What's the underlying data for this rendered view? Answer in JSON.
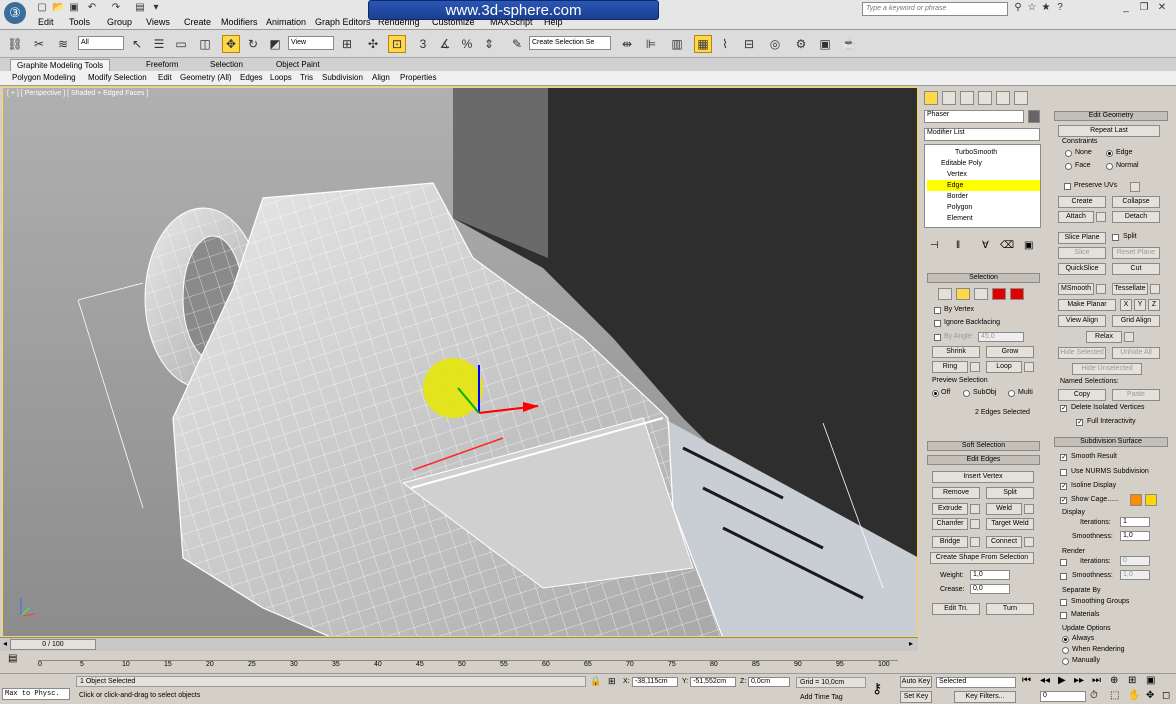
{
  "menubar": {
    "items": [
      "Edit",
      "Tools",
      "Group",
      "Views",
      "Create",
      "Modifiers",
      "Animation",
      "Graph Editors",
      "Rendering",
      "Customize",
      "MAXScript",
      "Help"
    ],
    "watermark": "www.3d-sphere.com",
    "search_placeholder": "Type a keyword or phrase"
  },
  "toolbar": {
    "selection_filter": "All",
    "ref_coord": "View",
    "named_selection": "Create Selection Se"
  },
  "ribbon": {
    "tabs": [
      "Graphite Modeling Tools",
      "Freeform",
      "Selection",
      "Object Paint"
    ],
    "items": [
      "Polygon Modeling",
      "Modify Selection",
      "Edit",
      "Geometry (All)",
      "Edges",
      "Loops",
      "Tris",
      "Subdivision",
      "Align",
      "Properties"
    ]
  },
  "viewport": {
    "label": "[ + ] [ Perspective ] [ Shaded + Edged Faces ]"
  },
  "panel": {
    "object_name": "Phaser",
    "modifier_list": "Modifier List",
    "stack": [
      "TurboSmooth",
      "Editable Poly",
      "Vertex",
      "Edge",
      "Border",
      "Polygon",
      "Element"
    ],
    "selection": {
      "header": "Selection",
      "by_vertex": "By Vertex",
      "ignore_backfacing": "Ignore Backfacing",
      "by_angle": "By Angle:",
      "angle_value": "45,0",
      "shrink": "Shrink",
      "grow": "Grow",
      "ring": "Ring",
      "loop": "Loop",
      "preview": "Preview Selection",
      "off": "Off",
      "subobj": "SubObj",
      "multi": "Multi",
      "status": "2 Edges Selected"
    },
    "soft_selection": "Soft Selection",
    "edit_edges": {
      "header": "Edit Edges",
      "insert_vertex": "Insert Vertex",
      "remove": "Remove",
      "split": "Split",
      "extrude": "Extrude",
      "weld": "Weld",
      "chamfer": "Chamfer",
      "target_weld": "Target Weld",
      "bridge": "Bridge",
      "connect": "Connect",
      "create_shape": "Create Shape From Selection",
      "weight": "Weight:",
      "weight_value": "1,0",
      "crease": "Crease:",
      "crease_value": "0,0",
      "edit_tri": "Edit Tri.",
      "turn": "Turn"
    }
  },
  "panel2": {
    "edit_geometry": {
      "header": "Edit Geometry",
      "repeat_last": "Repeat Last",
      "constraints": "Constraints",
      "none": "None",
      "edge": "Edge",
      "face": "Face",
      "normal": "Normal",
      "preserve_uvs": "Preserve UVs",
      "create": "Create",
      "collapse": "Collapse",
      "attach": "Attach",
      "detach": "Detach",
      "slice_plane": "Slice Plane",
      "split": "Split",
      "slice": "Slice",
      "reset_plane": "Reset Plane",
      "quickslice": "QuickSlice",
      "cut": "Cut",
      "msmooth": "MSmooth",
      "tessellate": "Tessellate",
      "make_planar": "Make Planar",
      "x": "X",
      "y": "Y",
      "z": "Z",
      "view_align": "View Align",
      "grid_align": "Grid Align",
      "relax": "Relax",
      "hide_selected": "Hide Selected",
      "unhide_all": "Unhide All",
      "hide_unselected": "Hide Unselected",
      "named_selections": "Named Selections:",
      "copy": "Copy",
      "paste": "Paste",
      "delete_isolated": "Delete Isolated Vertices",
      "full_interactivity": "Full Interactivity"
    },
    "subdivision_surface": {
      "header": "Subdivision Surface",
      "smooth_result": "Smooth Result",
      "use_nurms": "Use NURMS Subdivision",
      "isoline": "Isoline Display",
      "show_cage": "Show Cage......",
      "display": "Display",
      "iterations": "Iterations:",
      "iter_value": "1",
      "smoothness": "Smoothness:",
      "smooth_value": "1,0",
      "render": "Render",
      "r_iter_value": "0",
      "r_smooth_value": "1,0",
      "separate_by": "Separate By",
      "smoothing_groups": "Smoothing Groups",
      "materials": "Materials",
      "update_options": "Update Options",
      "always": "Always",
      "when_rendering": "When Rendering",
      "manually": "Manually"
    },
    "cage_colors": [
      "#ff8c00",
      "#ffd700"
    ]
  },
  "timeline": {
    "frame": "0 / 100",
    "ticks": [
      "0",
      "5",
      "10",
      "15",
      "20",
      "25",
      "30",
      "35",
      "40",
      "45",
      "50",
      "55",
      "60",
      "65",
      "70",
      "75",
      "80",
      "85",
      "90",
      "95",
      "100"
    ]
  },
  "status": {
    "script_listener": "Max to Physc.",
    "objects_selected": "1 Object Selected",
    "prompt": "Click or click-and-drag to select objects",
    "x_label": "X:",
    "x_value": "-38,115cm",
    "y_label": "Y:",
    "y_value": "-51,552cm",
    "z_label": "Z:",
    "z_value": "0,0cm",
    "grid": "Grid = 10,0cm",
    "add_time_tag": "Add Time Tag",
    "auto_key": "Auto Key",
    "set_key": "Set Key",
    "key_mode": "Selected",
    "key_filters": "Key Filters...",
    "current_frame": "0"
  }
}
